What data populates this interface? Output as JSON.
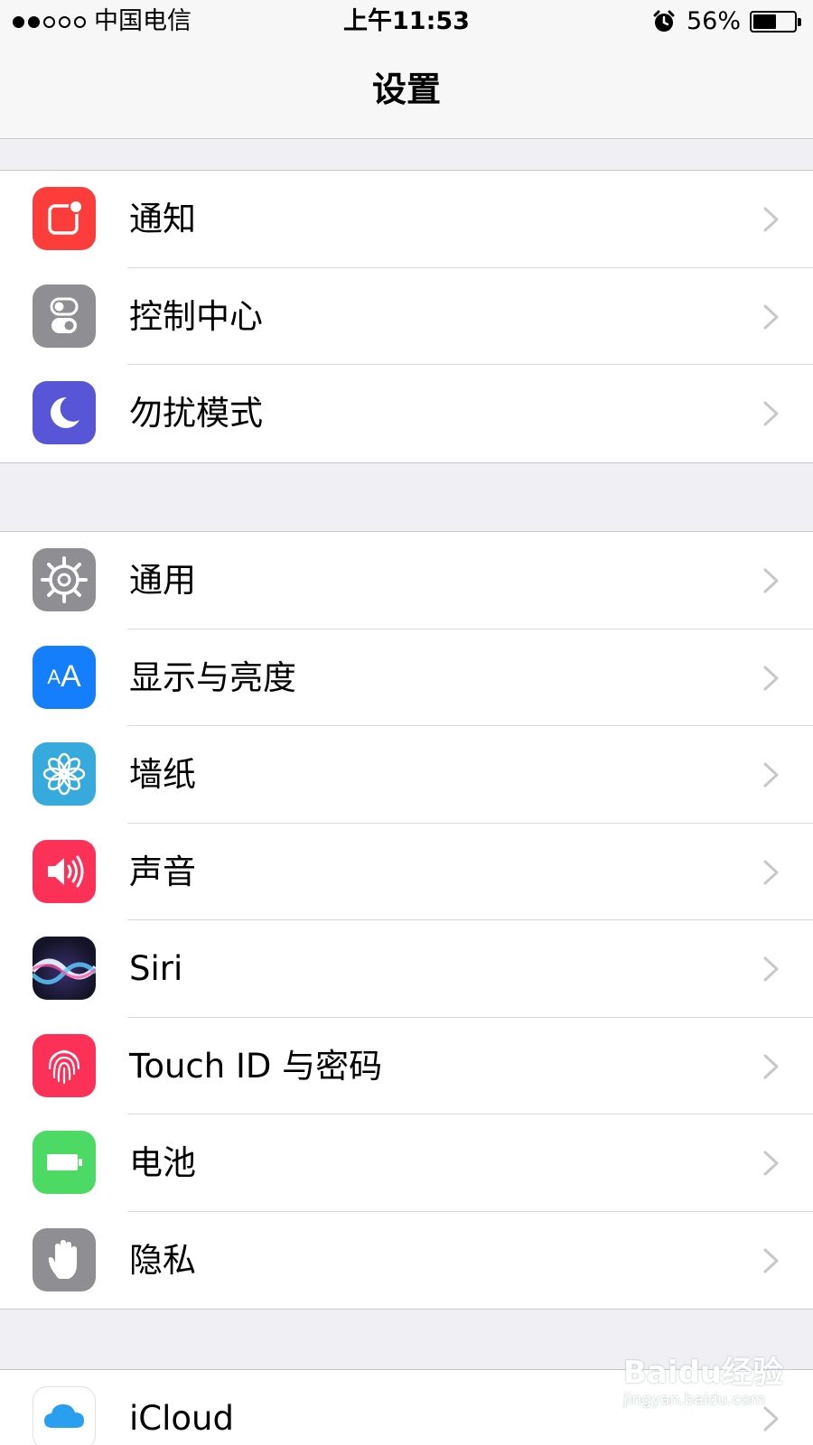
{
  "status_bar": {
    "carrier": "中国电信",
    "time": "上午11:53",
    "battery_percent": "56%",
    "battery_level": 0.56,
    "signal_bars_filled": 2,
    "signal_bars_total": 5
  },
  "nav": {
    "title": "设置"
  },
  "groups": [
    {
      "items": [
        {
          "label": "通知",
          "icon": "notifications-icon",
          "color": "#fc3d39"
        },
        {
          "label": "控制中心",
          "icon": "control-center-icon",
          "color": "#8e8e93"
        },
        {
          "label": "勿扰模式",
          "icon": "moon-icon",
          "color": "#5856d6"
        }
      ]
    },
    {
      "items": [
        {
          "label": "通用",
          "icon": "gear-icon",
          "color": "#8e8e93"
        },
        {
          "label": "显示与亮度",
          "icon": "display-brightness-icon",
          "color": "#147efb",
          "glyph": "AA"
        },
        {
          "label": "墙纸",
          "icon": "wallpaper-flower-icon",
          "color": "#36aadc"
        },
        {
          "label": "声音",
          "icon": "speaker-icon",
          "color": "#fc3158"
        },
        {
          "label": "Siri",
          "icon": "siri-icon",
          "color": "#1b1b3a"
        },
        {
          "label": "Touch ID 与密码",
          "icon": "fingerprint-icon",
          "color": "#fc3158"
        },
        {
          "label": "电池",
          "icon": "battery-icon",
          "color": "#4cd964"
        },
        {
          "label": "隐私",
          "icon": "hand-icon",
          "color": "#8e8e93"
        }
      ]
    },
    {
      "items": [
        {
          "label": "iCloud",
          "icon": "icloud-icon",
          "color": "#ffffff"
        }
      ]
    }
  ],
  "watermark": {
    "main": "Baidu经验",
    "sub": "jingyan.baidu.com"
  },
  "accent_colors": {
    "background": "#efeff4",
    "separator": "#c8c7cc",
    "chevron": "#c7c7cc"
  }
}
